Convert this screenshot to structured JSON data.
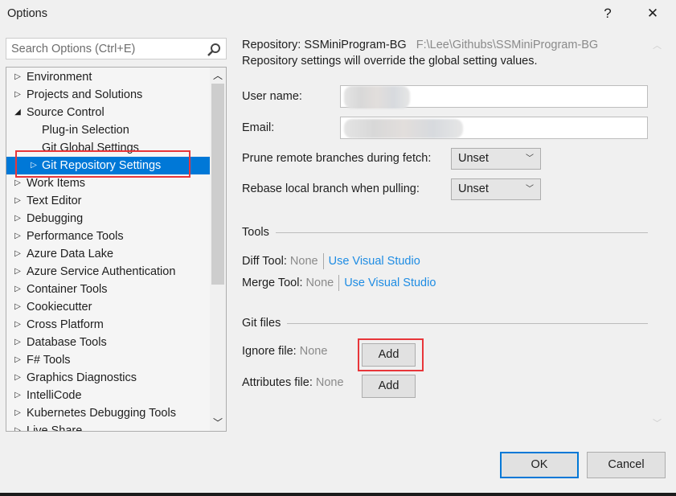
{
  "window": {
    "title": "Options",
    "help_label": "?",
    "close_label": "✕"
  },
  "search": {
    "placeholder": "Search Options (Ctrl+E)"
  },
  "tree": {
    "items": [
      {
        "label": "Environment",
        "arrow": "▷",
        "level": 0
      },
      {
        "label": "Projects and Solutions",
        "arrow": "▷",
        "level": 0
      },
      {
        "label": "Source Control",
        "arrow": "◢",
        "level": 0
      },
      {
        "label": "Plug-in Selection",
        "arrow": "",
        "level": 1
      },
      {
        "label": "Git Global Settings",
        "arrow": "",
        "level": 1
      },
      {
        "label": "Git Repository Settings",
        "arrow": "▷",
        "level": 1,
        "selected": true
      },
      {
        "label": "Work Items",
        "arrow": "▷",
        "level": 0
      },
      {
        "label": "Text Editor",
        "arrow": "▷",
        "level": 0
      },
      {
        "label": "Debugging",
        "arrow": "▷",
        "level": 0
      },
      {
        "label": "Performance Tools",
        "arrow": "▷",
        "level": 0
      },
      {
        "label": "Azure Data Lake",
        "arrow": "▷",
        "level": 0
      },
      {
        "label": "Azure Service Authentication",
        "arrow": "▷",
        "level": 0
      },
      {
        "label": "Container Tools",
        "arrow": "▷",
        "level": 0
      },
      {
        "label": "Cookiecutter",
        "arrow": "▷",
        "level": 0
      },
      {
        "label": "Cross Platform",
        "arrow": "▷",
        "level": 0
      },
      {
        "label": "Database Tools",
        "arrow": "▷",
        "level": 0
      },
      {
        "label": "F# Tools",
        "arrow": "▷",
        "level": 0
      },
      {
        "label": "Graphics Diagnostics",
        "arrow": "▷",
        "level": 0
      },
      {
        "label": "IntelliCode",
        "arrow": "▷",
        "level": 0
      },
      {
        "label": "Kubernetes Debugging Tools",
        "arrow": "▷",
        "level": 0
      },
      {
        "label": "Live Share",
        "arrow": "▷",
        "level": 0
      }
    ]
  },
  "main": {
    "repo_label": "Repository: SSMiniProgram-BG",
    "repo_path": "F:\\Lee\\Githubs\\SSMiniProgram-BG",
    "repo_note": "Repository settings will override the global setting values.",
    "user_name_label": "User name:",
    "email_label": "Email:",
    "prune_label": "Prune remote branches during fetch:",
    "prune_value": "Unset",
    "rebase_label": "Rebase local branch when pulling:",
    "rebase_value": "Unset",
    "tools_header": "Tools",
    "diff_label": "Diff Tool:",
    "diff_value": "None",
    "diff_link": "Use Visual Studio",
    "merge_label": "Merge Tool:",
    "merge_value": "None",
    "merge_link": "Use Visual Studio",
    "gitfiles_header": "Git files",
    "ignore_label": "Ignore file:",
    "ignore_value": "None",
    "ignore_button": "Add",
    "attr_label": "Attributes file:",
    "attr_value": "None",
    "attr_button": "Add"
  },
  "footer": {
    "ok": "OK",
    "cancel": "Cancel"
  }
}
